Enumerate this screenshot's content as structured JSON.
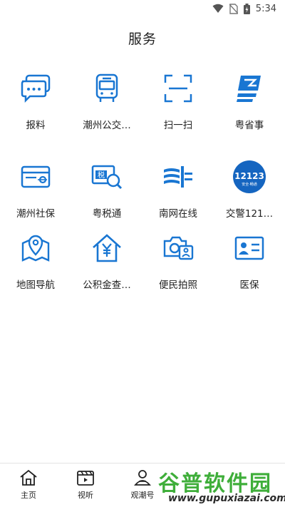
{
  "status_bar": {
    "time": "5:34"
  },
  "page": {
    "title": "服务"
  },
  "services": [
    {
      "label": "报料",
      "icon": "chat-bubbles-icon"
    },
    {
      "label": "潮州公交…",
      "icon": "bus-icon"
    },
    {
      "label": "扫一扫",
      "icon": "scan-icon"
    },
    {
      "label": "粤省事",
      "icon": "yue-shengshi-logo-icon"
    },
    {
      "label": "潮州社保",
      "icon": "social-security-card-icon"
    },
    {
      "label": "粤税通",
      "icon": "tax-search-icon"
    },
    {
      "label": "南网在线",
      "icon": "power-grid-icon"
    },
    {
      "label": "交警121…",
      "icon": "traffic-police-12123-icon",
      "icon_text": "12123",
      "icon_subtext": "安全·畅通"
    },
    {
      "label": "地图导航",
      "icon": "map-pin-icon"
    },
    {
      "label": "公积金查…",
      "icon": "housing-fund-icon"
    },
    {
      "label": "便民拍照",
      "icon": "camera-id-icon"
    },
    {
      "label": "医保",
      "icon": "medical-insurance-card-icon"
    }
  ],
  "bottom_nav": [
    {
      "label": "主页",
      "icon": "home-icon"
    },
    {
      "label": "视听",
      "icon": "video-clapper-icon"
    },
    {
      "label": "观潮号",
      "icon": "person-badge-icon"
    }
  ],
  "watermark": {
    "main": "谷普软件园",
    "url": "www.gupuxiazai.com"
  },
  "colors": {
    "accent": "#1976d2",
    "text": "#222222",
    "watermark": "#3fae3a"
  }
}
